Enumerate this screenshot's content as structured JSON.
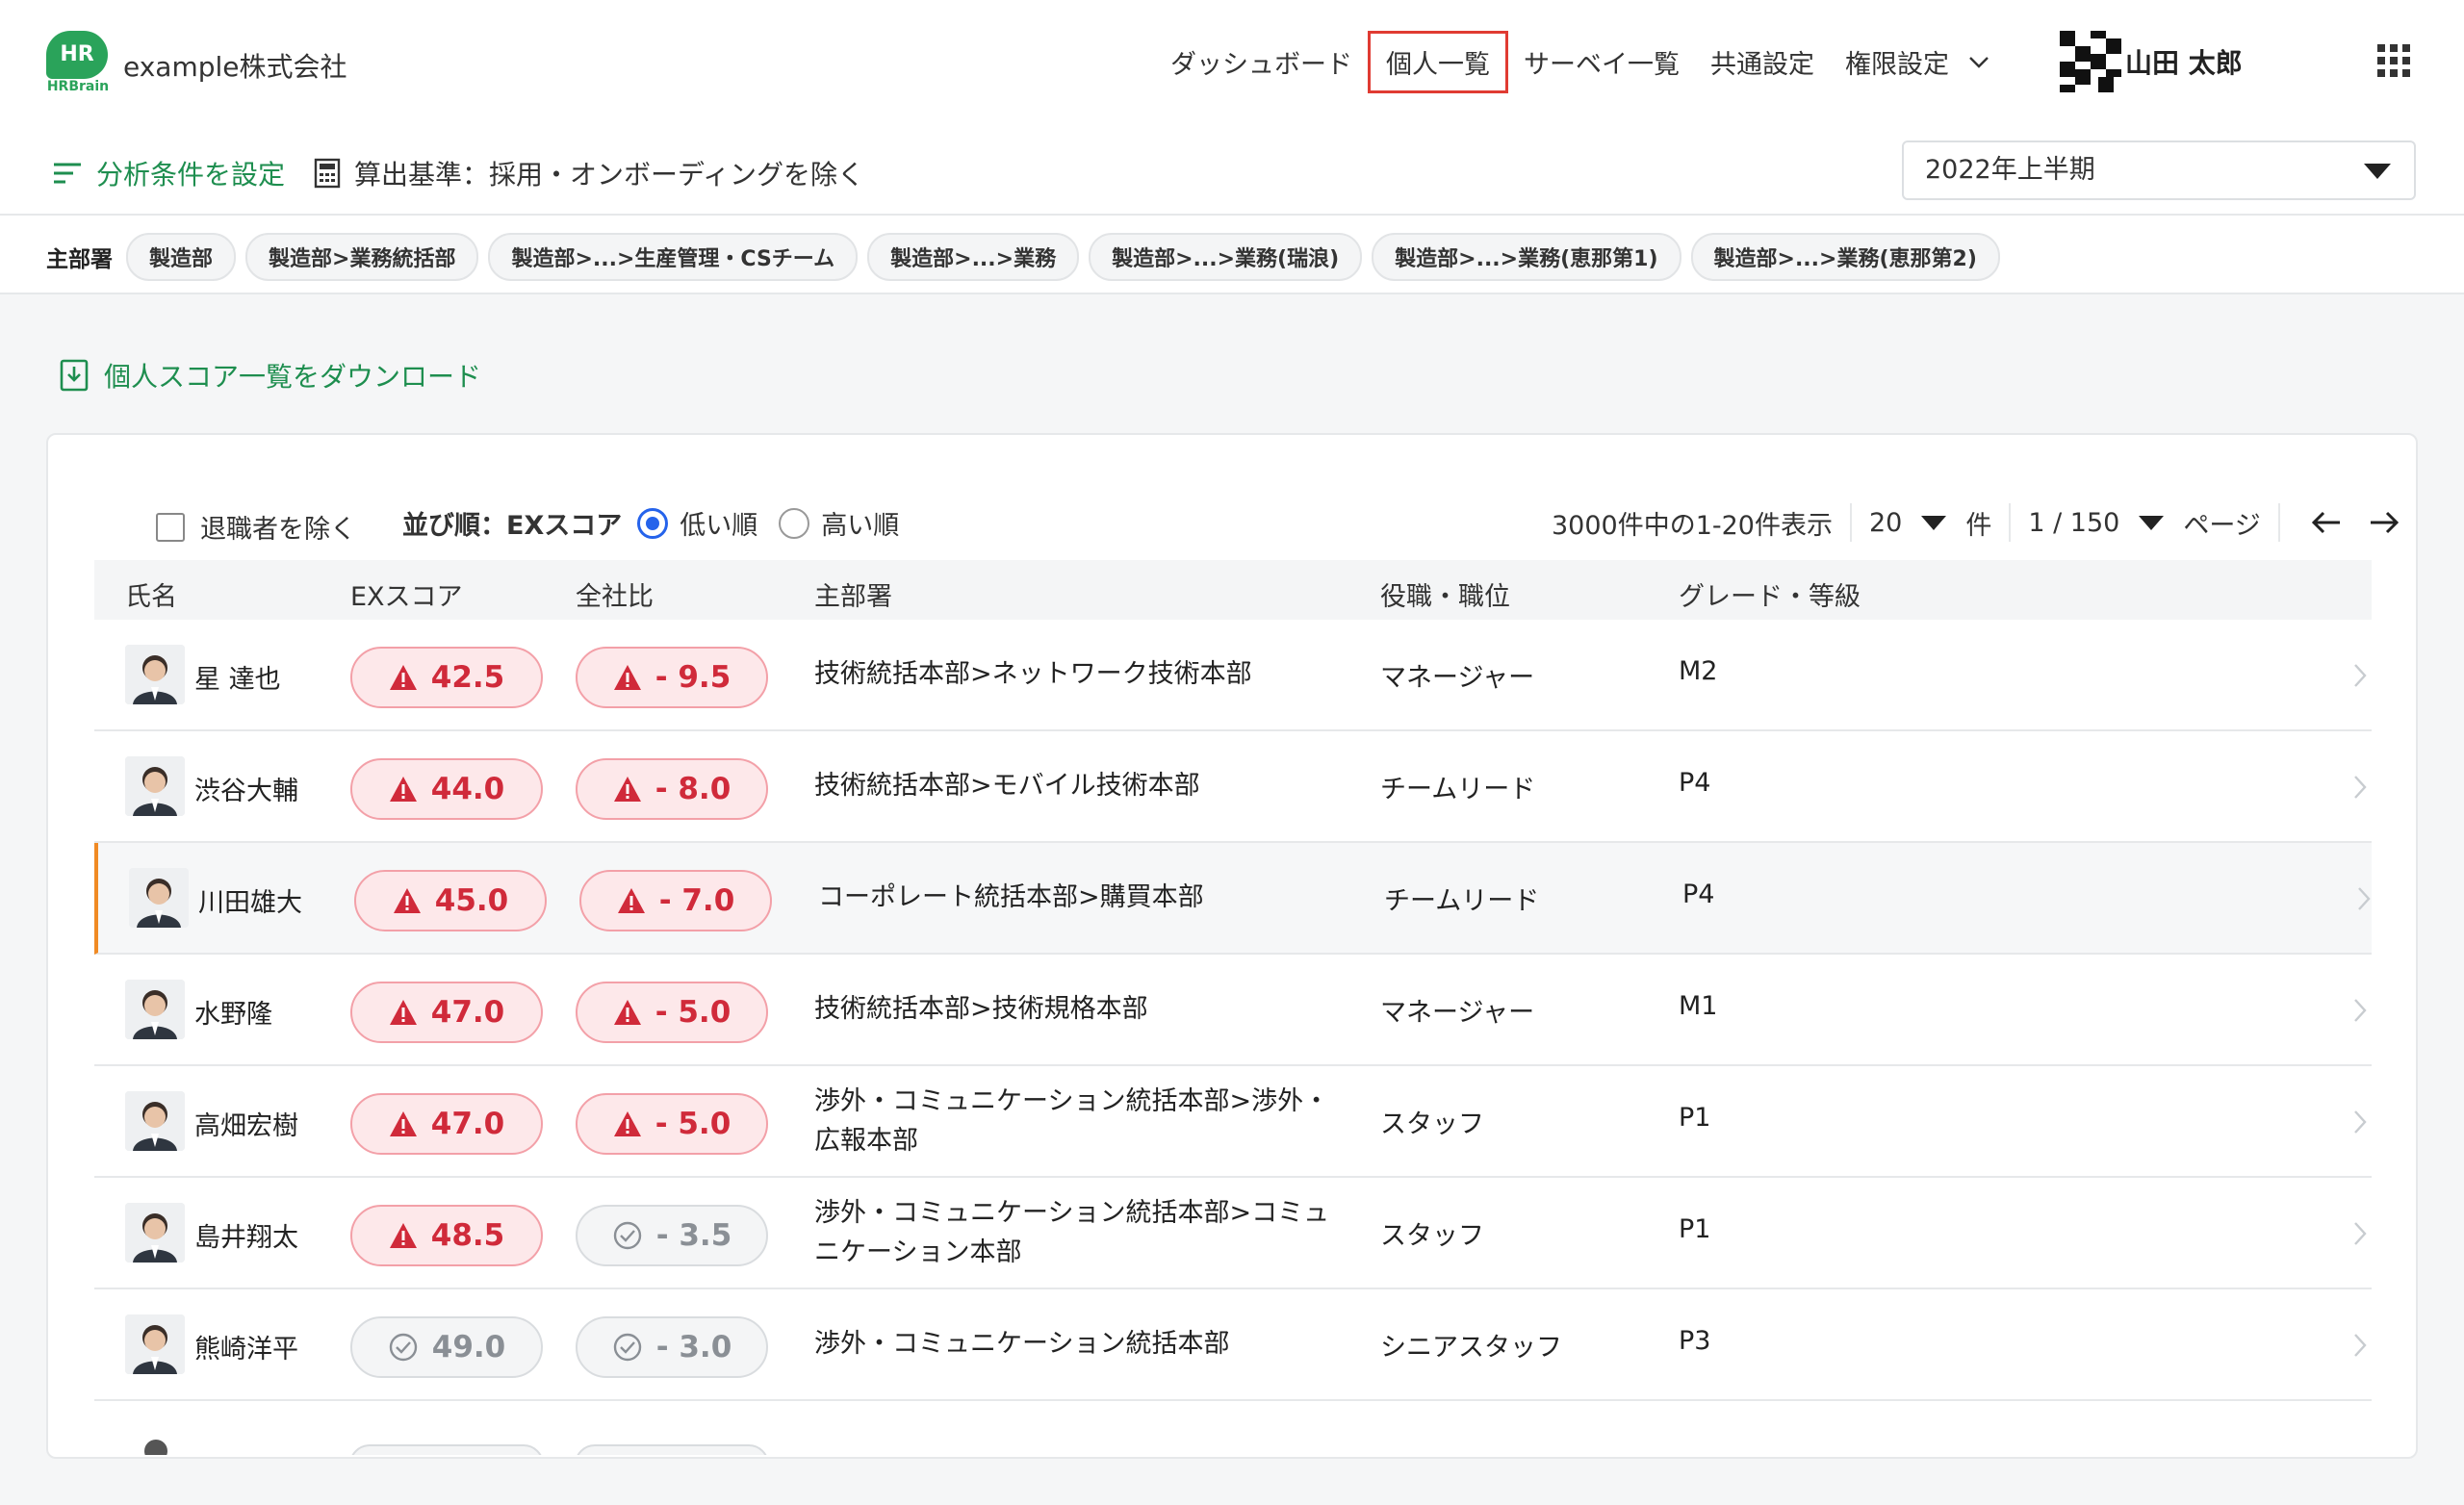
{
  "header": {
    "logo_text": "HR",
    "logo_sub": "HRBrain",
    "company": "example株式会社",
    "nav": [
      {
        "label": "ダッシュボード"
      },
      {
        "label": "個人一覧"
      },
      {
        "label": "サーベイ一覧"
      },
      {
        "label": "共通設定"
      },
      {
        "label": "権限設定"
      }
    ],
    "active_nav": "個人一覧",
    "user_name": "山田 太郎"
  },
  "conditions": {
    "set_label": "分析条件を設定",
    "basis_label": "算出基準：採用・オンボーディングを除く",
    "period": "2022年上半期"
  },
  "departments": {
    "label": "主部署",
    "chips": [
      "製造部",
      "製造部>業務統括部",
      "製造部>...>生産管理・CSチーム",
      "製造部>...>業務",
      "製造部>...>業務(瑞浪)",
      "製造部>...>業務(恵那第1)",
      "製造部>...>業務(恵那第2)"
    ]
  },
  "download_label": "個人スコア一覧をダウンロード",
  "controls": {
    "exclude_retired": "退職者を除く",
    "sort_label": "並び順：EXスコア",
    "sort_low": "低い順",
    "sort_high": "高い順",
    "count_text": "3000件中の1-20件表示",
    "per_page": "20",
    "per_page_unit": "件",
    "page": "1 / 150",
    "page_unit": "ページ"
  },
  "table": {
    "headers": [
      "氏名",
      "EXスコア",
      "全社比",
      "主部署",
      "役職・職位",
      "グレード・等級"
    ],
    "rows": [
      {
        "name": "星 達也",
        "score": "42.5",
        "score_status": "warn",
        "diff": "- 9.5",
        "diff_status": "warn",
        "dept": "技術統括本部>ネットワーク技術本部",
        "role": "マネージャー",
        "grade": "M2"
      },
      {
        "name": "渋谷大輔",
        "score": "44.0",
        "score_status": "warn",
        "diff": "- 8.0",
        "diff_status": "warn",
        "dept": "技術統括本部>モバイル技術本部",
        "role": "チームリード",
        "grade": "P4"
      },
      {
        "name": "川田雄大",
        "score": "45.0",
        "score_status": "warn",
        "diff": "- 7.0",
        "diff_status": "warn",
        "dept": "コーポレート統括本部>購買本部",
        "role": "チームリード",
        "grade": "P4"
      },
      {
        "name": "水野隆",
        "score": "47.0",
        "score_status": "warn",
        "diff": "- 5.0",
        "diff_status": "warn",
        "dept": "技術統括本部>技術規格本部",
        "role": "マネージャー",
        "grade": "M1"
      },
      {
        "name": "高畑宏樹",
        "score": "47.0",
        "score_status": "warn",
        "diff": "- 5.0",
        "diff_status": "warn",
        "dept": "渉外・コミュニケーション統括本部>渉外・広報本部",
        "role": "スタッフ",
        "grade": "P1"
      },
      {
        "name": "島井翔太",
        "score": "48.5",
        "score_status": "warn",
        "diff": "- 3.5",
        "diff_status": "ok",
        "dept": "渉外・コミュニケーション統括本部>コミュニケーション本部",
        "role": "スタッフ",
        "grade": "P1"
      },
      {
        "name": "熊崎洋平",
        "score": "49.0",
        "score_status": "ok",
        "diff": "- 3.0",
        "diff_status": "ok",
        "dept": "渉外・コミュニケーション統括本部",
        "role": "シニアスタッフ",
        "grade": "P3"
      }
    ],
    "selected_row": 2
  },
  "colors": {
    "accent_green": "#1e8e4f",
    "warn_red": "#d02a3a",
    "active_nav_border": "#e03b32",
    "selected_row_marker": "#f08a24",
    "radio_blue": "#2563eb"
  }
}
